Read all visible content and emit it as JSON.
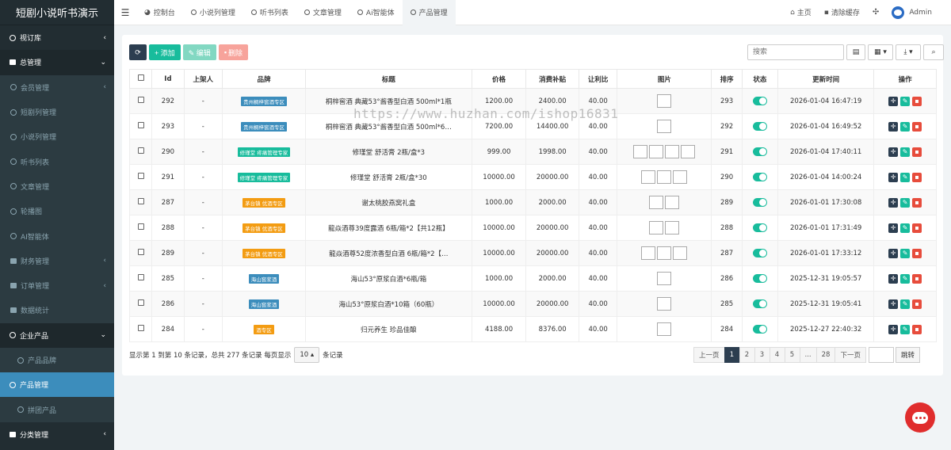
{
  "app": {
    "title": "短剧小说听书演示"
  },
  "sidebar": {
    "items": [
      {
        "label": "视订库",
        "kind": "top",
        "icon": "circle-icon",
        "caret": "‹"
      },
      {
        "label": "总管理",
        "kind": "open",
        "icon": "list-icon",
        "caret": "⌄"
      },
      {
        "label": "会员管理",
        "kind": "sub",
        "icon": "user-icon",
        "caret": "‹"
      },
      {
        "label": "短剧列管理",
        "kind": "sub",
        "icon": "circle-icon",
        "caret": ""
      },
      {
        "label": "小说列管理",
        "kind": "sub",
        "icon": "circle-icon",
        "caret": ""
      },
      {
        "label": "听书列表",
        "kind": "sub",
        "icon": "circle-icon",
        "caret": ""
      },
      {
        "label": "文章管理",
        "kind": "sub",
        "icon": "circle-icon",
        "caret": ""
      },
      {
        "label": "轮播图",
        "kind": "sub",
        "icon": "circle-icon",
        "caret": ""
      },
      {
        "label": "AI智能体",
        "kind": "sub",
        "icon": "circle-icon",
        "caret": ""
      },
      {
        "label": "财务管理",
        "kind": "sub",
        "icon": "money-icon",
        "caret": "‹"
      },
      {
        "label": "订单管理",
        "kind": "sub",
        "icon": "cart-icon",
        "caret": "‹"
      },
      {
        "label": "数据统计",
        "kind": "sub",
        "icon": "chart-icon",
        "caret": ""
      },
      {
        "label": "企业产品",
        "kind": "open",
        "icon": "circle-icon",
        "caret": "⌄"
      },
      {
        "label": "产品品牌",
        "kind": "sub2",
        "icon": "circle-icon",
        "caret": ""
      },
      {
        "label": "产品管理",
        "kind": "active",
        "icon": "circle-icon",
        "caret": ""
      },
      {
        "label": "拼团产品",
        "kind": "sub2",
        "icon": "circle-icon",
        "caret": ""
      },
      {
        "label": "分类管理",
        "kind": "top",
        "icon": "leaf-icon",
        "caret": "‹"
      }
    ]
  },
  "topbar": {
    "tabs": [
      {
        "label": "控制台",
        "active": false
      },
      {
        "label": "小说列管理",
        "active": false
      },
      {
        "label": "听书列表",
        "active": false
      },
      {
        "label": "文章管理",
        "active": false
      },
      {
        "label": "Ai智能体",
        "active": false
      },
      {
        "label": "产品管理",
        "active": true
      }
    ],
    "home_label": "主页",
    "clear_cache_label": "清除缓存",
    "user_label": "Admin"
  },
  "toolbar": {
    "add_label": "+ 添加",
    "edit_label": "✎ 编辑",
    "delete_label": "删除",
    "search_placeholder": "搜索"
  },
  "table": {
    "headers": [
      "",
      "Id",
      "上架人",
      "品牌",
      "标题",
      "价格",
      "消费补贴",
      "让利比",
      "图片",
      "排序",
      "状态",
      "更新时间",
      "操作"
    ],
    "rows": [
      {
        "id": "292",
        "seller": "-",
        "brand": "贵州桐梓窖酒专区",
        "brand_color": "#3c8dbc",
        "title": "桐梓窖酒 典藏53°酱香型白酒 500ml*1瓶",
        "price": "1200.00",
        "subsidy": "2400.00",
        "ratio": "40.00",
        "images": 1,
        "sort": "293",
        "time": "2026-01-04 16:47:19"
      },
      {
        "id": "293",
        "seller": "-",
        "brand": "贵州桐梓窖酒专区",
        "brand_color": "#3c8dbc",
        "title": "桐梓窖酒 典藏53°酱香型白酒 500ml*6…",
        "price": "7200.00",
        "subsidy": "14400.00",
        "ratio": "40.00",
        "images": 1,
        "sort": "292",
        "time": "2026-01-04 16:49:52"
      },
      {
        "id": "290",
        "seller": "-",
        "brand": "修瑾堂 疼痛管理专家",
        "brand_color": "#18bc9c",
        "title": "修瑾堂 舒活膏 2瓶/盒*3",
        "price": "999.00",
        "subsidy": "1998.00",
        "ratio": "40.00",
        "images": 4,
        "sort": "291",
        "time": "2026-01-04 17:40:11"
      },
      {
        "id": "291",
        "seller": "-",
        "brand": "修瑾堂 疼痛管理专家",
        "brand_color": "#18bc9c",
        "title": "修瑾堂 舒活膏 2瓶/盒*30",
        "price": "10000.00",
        "subsidy": "20000.00",
        "ratio": "40.00",
        "images": 3,
        "sort": "290",
        "time": "2026-01-04 14:00:24"
      },
      {
        "id": "287",
        "seller": "-",
        "brand": "茅台镇 优酒专区",
        "brand_color": "#f39c12",
        "title": "谢太桃胶燕窝礼盒",
        "price": "1000.00",
        "subsidy": "2000.00",
        "ratio": "40.00",
        "images": 2,
        "sort": "289",
        "time": "2026-01-01 17:30:08"
      },
      {
        "id": "288",
        "seller": "-",
        "brand": "茅台镇 优酒专区",
        "brand_color": "#f39c12",
        "title": "龍焱酒尊39度露酒 6瓶/箱*2【共12瓶】",
        "price": "10000.00",
        "subsidy": "20000.00",
        "ratio": "40.00",
        "images": 2,
        "sort": "288",
        "time": "2026-01-01 17:31:49"
      },
      {
        "id": "289",
        "seller": "-",
        "brand": "茅台镇 优酒专区",
        "brand_color": "#f39c12",
        "title": "龍焱酒尊52度浓香型白酒 6瓶/箱*2【…",
        "price": "10000.00",
        "subsidy": "20000.00",
        "ratio": "40.00",
        "images": 3,
        "sort": "287",
        "time": "2026-01-01 17:33:12"
      },
      {
        "id": "285",
        "seller": "-",
        "brand": "海山窖浆酒",
        "brand_color": "#3c8dbc",
        "title": "海山53°原浆白酒*6瓶/箱",
        "price": "1000.00",
        "subsidy": "2000.00",
        "ratio": "40.00",
        "images": 1,
        "sort": "286",
        "time": "2025-12-31 19:05:57"
      },
      {
        "id": "286",
        "seller": "-",
        "brand": "海山窖浆酒",
        "brand_color": "#3c8dbc",
        "title": "海山53°原浆白酒*10箱（60瓶）",
        "price": "10000.00",
        "subsidy": "20000.00",
        "ratio": "40.00",
        "images": 1,
        "sort": "285",
        "time": "2025-12-31 19:05:41"
      },
      {
        "id": "284",
        "seller": "-",
        "brand": "酒专区",
        "brand_color": "#f39c12",
        "title": "归元养生 珍品佳酿",
        "price": "4188.00",
        "subsidy": "8376.00",
        "ratio": "40.00",
        "images": 1,
        "sort": "284",
        "time": "2025-12-27 22:40:32"
      }
    ]
  },
  "footer": {
    "info_prefix": "显示第 1 到第 10 条记录，总共 277 条记录 每页显示",
    "page_size": "10 ▴",
    "info_suffix": "条记录",
    "pages": [
      "上一页",
      "1",
      "2",
      "3",
      "4",
      "5",
      "...",
      "28",
      "下一页"
    ],
    "current_page": "1",
    "jump_label": "跳转"
  },
  "watermark": {
    "text": "https://www.huzhan.com/ishop16831"
  }
}
